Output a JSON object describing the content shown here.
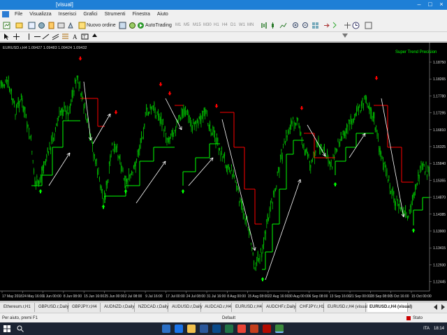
{
  "window": {
    "title": "[visual]",
    "minimize": "–",
    "maximize": "□",
    "close": "×"
  },
  "menu": [
    "File",
    "Visualizza",
    "Inserisci",
    "Grafici",
    "Strumenti",
    "Finestra",
    "Aiuto"
  ],
  "toolbar": {
    "new_order": "Nuovo ordine",
    "auto_trading": "AutoTrading"
  },
  "timeframes": [
    "M1",
    "M5",
    "M15",
    "M30",
    "H1",
    "H4",
    "D1",
    "W1",
    "MN"
  ],
  "chart": {
    "symbol_info": "EURUSD.r,H4  1.09427 1.09483 1.09424 1.09432",
    "indicator": "Super Trend Precision",
    "price_labels": [
      "1.18750",
      "1.18265",
      "1.17780",
      "1.17295",
      "1.16810",
      "1.16325",
      "1.15840",
      "1.15355",
      "1.14870",
      "1.14385",
      "1.13900",
      "1.13415",
      "1.12930",
      "1.12445"
    ],
    "date_labels": [
      "17 May 2018",
      "24 May 16:00",
      "1 Jun 00:00",
      "8 Jun 08:00",
      "15 Jun 16:00",
      "25 Jun 00:00",
      "2 Jul 08:00",
      "9 Jul 16:00",
      "17 Jul 00:00",
      "24 Jul 08:00",
      "31 Jul 16:00",
      "8 Aug 00:00",
      "15 Aug 08:00",
      "22 Aug 16:00",
      "30 Aug 00:00",
      "6 Sep 08:00",
      "13 Sep 16:00",
      "21 Sep 00:00",
      "28 Sep 08:00",
      "5 Oct 16:00",
      "15 Oct 00:00"
    ],
    "colors": {
      "candles": "#00c000",
      "trend_up": "#00ff00",
      "trend_down": "#ff0000",
      "arrow_up": "#00ff00",
      "arrow_down": "#ff0000",
      "annotations": "#ffffff"
    }
  },
  "tabs": [
    "Ethereum.r,H1",
    "GBPUSD.r,Daily",
    "GBPJPY.r,H4",
    "AUDNZD.r,Daily",
    "NZDCAD.r,Daily",
    "AUDUSD.r,Daily",
    "AUDCAD.r,H4",
    "EURUSD.r,H4",
    "AUDCHF.r,Daily",
    "CHFJPY.r,H1",
    "EURUSD.r,H4 (visual)",
    "EURUSD.r,H4 (visual)"
  ],
  "status": {
    "help": "Per aiuto, premi F1",
    "profile": "Default",
    "connection": "Stato connessione"
  },
  "tray": {
    "language": "ITA",
    "time": "18:14"
  }
}
